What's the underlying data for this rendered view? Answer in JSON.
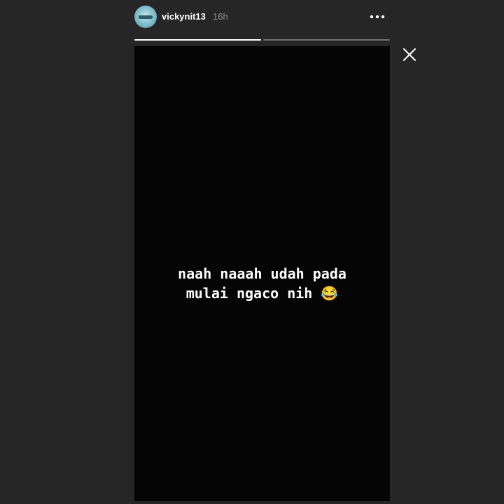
{
  "story": {
    "username": "vickynit13",
    "time_ago": "16h",
    "text": "naah naaah udah pada\nmulai ngaco nih 😂",
    "progress": {
      "segments_total": 2,
      "current_segment": 2,
      "current_segment_fill": 0.0
    }
  },
  "icons": {
    "avatar": "profile-avatar",
    "more": "more-horizontal-icon",
    "close": "close-icon"
  },
  "colors": {
    "page_background": "#262626",
    "story_background": "#050505",
    "text": "#ffffff",
    "timestamp": "#8e8e8e"
  }
}
